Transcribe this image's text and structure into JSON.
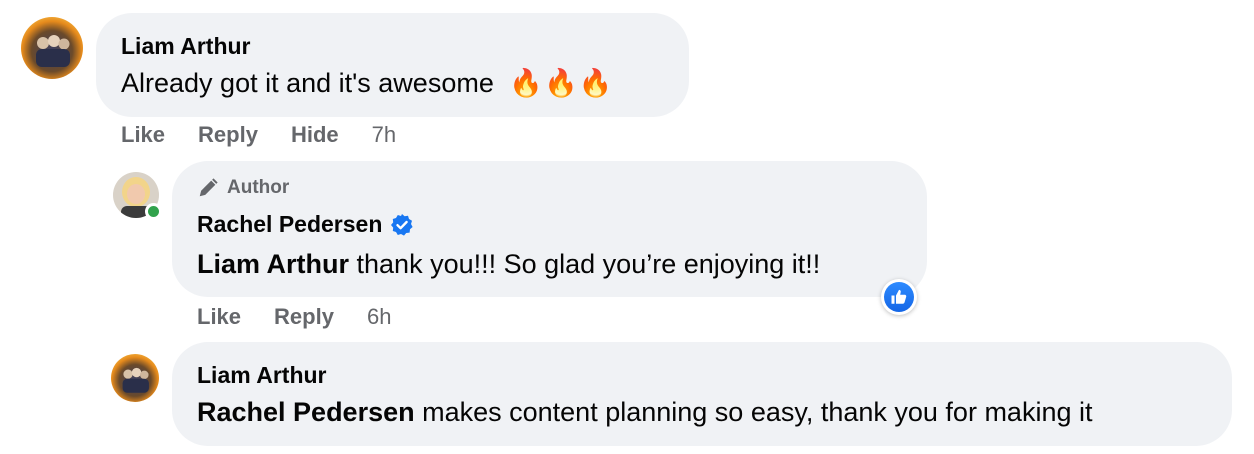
{
  "comments": [
    {
      "author": "Liam Arthur",
      "text": "Already got it and it's awesome",
      "emoji": "🔥🔥🔥",
      "actions": {
        "like": "Like",
        "reply": "Reply",
        "hide": "Hide",
        "time": "7h"
      }
    },
    {
      "badge": "Author",
      "author": "Rachel Pedersen",
      "verified": true,
      "mention": "Liam Arthur",
      "text": " thank you!!! So glad you’re enjoying it!!",
      "reaction": "like-icon",
      "actions": {
        "like": "Like",
        "reply": "Reply",
        "time": "6h"
      }
    },
    {
      "author": "Liam Arthur",
      "mention": "Rachel Pedersen",
      "text": " makes content planning so easy, thank you for making it"
    }
  ],
  "colors": {
    "bubble": "#f0f2f5",
    "secondary_text": "#65676b",
    "verified": "#1877f2",
    "online": "#31a24c"
  }
}
